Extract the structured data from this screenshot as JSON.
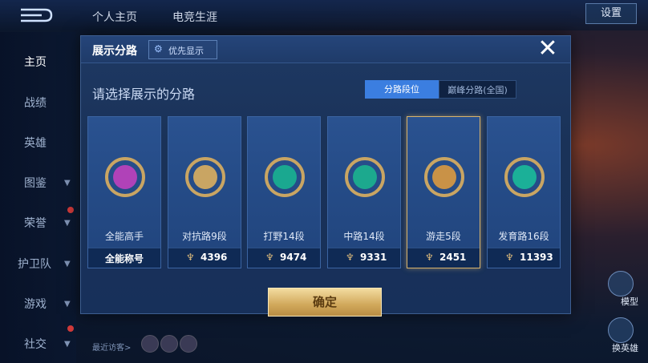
{
  "topbar": {
    "tabs": [
      "个人主页",
      "电竞生涯"
    ],
    "settings_label": "设置"
  },
  "sidebar": {
    "items": [
      "主页",
      "战绩",
      "英雄",
      "图鉴",
      "荣誉",
      "护卫队",
      "游戏",
      "社交"
    ]
  },
  "right_panel": {
    "model_label": "模型",
    "swap_label": "换英雄"
  },
  "recent_visitors_label": "最近访客>",
  "modal": {
    "title": "展示分路",
    "priority_label": "优先显示",
    "close_symbol": "✕",
    "subtitle": "请选择展示的分路",
    "segments": [
      "分路段位",
      "巅峰分路(全国)"
    ],
    "cards": [
      {
        "role": "全能高手",
        "footer": "全能称号",
        "badge_color": "#b042b8"
      },
      {
        "role": "对抗路9段",
        "footer": "4396",
        "badge_color": "#c9a563"
      },
      {
        "role": "打野14段",
        "footer": "9474",
        "badge_color": "#1aa890"
      },
      {
        "role": "中路14段",
        "footer": "9331",
        "badge_color": "#1ca98e"
      },
      {
        "role": "游走5段",
        "footer": "2451",
        "badge_color": "#c99247"
      },
      {
        "role": "发育路16段",
        "footer": "11393",
        "badge_color": "#1bb098"
      }
    ],
    "confirm_label": "确定"
  },
  "colors": {
    "accent_blue": "#3b7ee0",
    "gold": "#d8b36c"
  }
}
